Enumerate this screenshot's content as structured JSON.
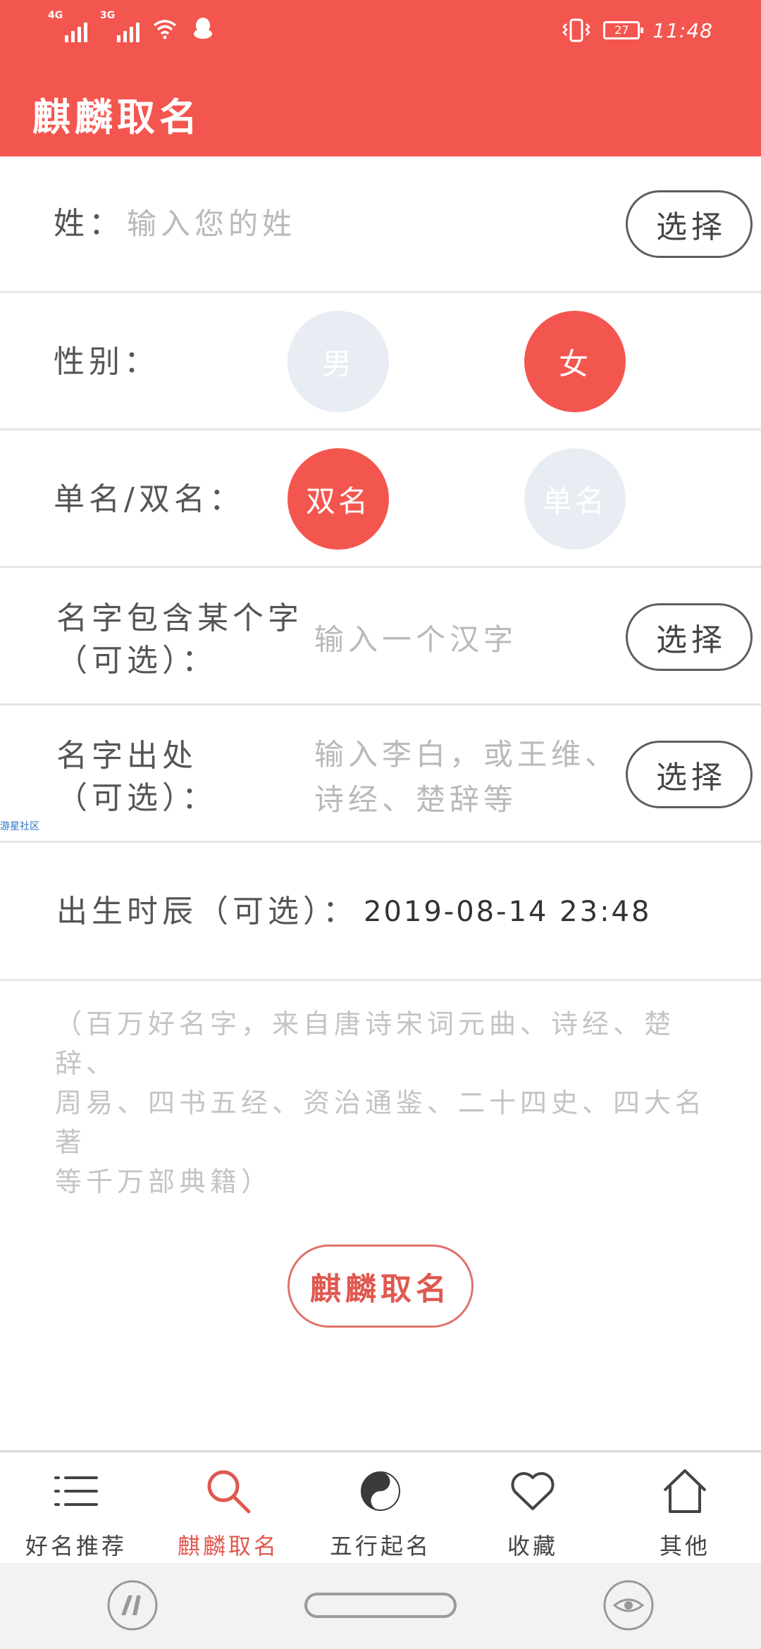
{
  "status_bar": {
    "signal_1_type": "4G",
    "signal_2_type": "3G",
    "battery_level": "27",
    "time": "11:48"
  },
  "app_bar": {
    "title": "麒麟取名"
  },
  "form": {
    "surname": {
      "label": "姓：",
      "placeholder": "输入您的姓",
      "button": "选择"
    },
    "gender": {
      "label": "性别：",
      "options": [
        "男",
        "女"
      ],
      "selected": "女"
    },
    "name_length": {
      "label": "单名/双名：",
      "options": [
        "双名",
        "单名"
      ],
      "selected": "双名"
    },
    "contains_char": {
      "label_line1": "名字包含某个字",
      "label_line2": "（可选）：",
      "placeholder": "输入一个汉字",
      "button": "选择"
    },
    "source": {
      "label_line1": "名字出处",
      "label_line2": "（可选）：",
      "placeholder_line1": "输入李白，或王维、",
      "placeholder_line2": "诗经、楚辞等",
      "button": "选择"
    },
    "birth_time": {
      "label": "出生时辰（可选）：",
      "value": "2019-08-14 23:48"
    }
  },
  "note": {
    "line1": "（百万好名字，来自唐诗宋词元曲、诗经、楚辞、",
    "line2": "周易、四书五经、资治通鉴、二十四史、四大名著",
    "line3": "等千万部典籍）"
  },
  "watermark": "游星社区",
  "main_button": "麒麟取名",
  "tabs": [
    {
      "label": "好名推荐",
      "icon": "list-icon"
    },
    {
      "label": "麒麟取名",
      "icon": "search-icon",
      "active": true
    },
    {
      "label": "五行起名",
      "icon": "yin-yang-icon"
    },
    {
      "label": "收藏",
      "icon": "heart-icon"
    },
    {
      "label": "其他",
      "icon": "home-icon"
    }
  ],
  "colors": {
    "accent": "#f3564f",
    "unselected_circle": "#e8ecf3",
    "placeholder": "#b9b9b9"
  }
}
